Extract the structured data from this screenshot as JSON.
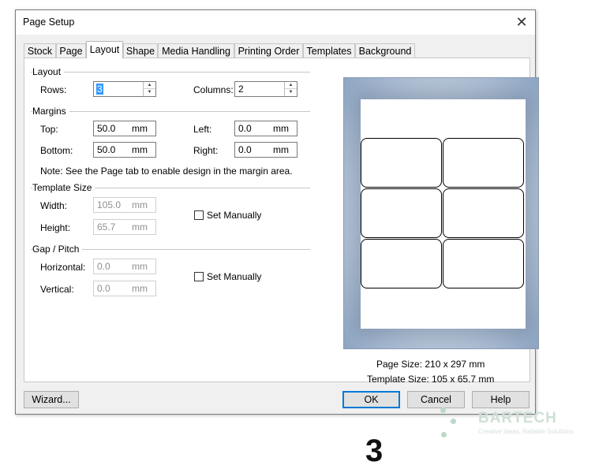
{
  "window": {
    "title": "Page Setup",
    "close_glyph": "✕"
  },
  "tabs": [
    "Stock",
    "Page",
    "Layout",
    "Shape",
    "Media Handling",
    "Printing Order",
    "Templates",
    "Background"
  ],
  "active_tab": "Layout",
  "layout": {
    "group": "Layout",
    "rows_label": "Rows:",
    "rows_value": "3",
    "columns_label": "Columns:",
    "columns_value": "2"
  },
  "margins": {
    "group": "Margins",
    "top_label": "Top:",
    "top_value": "50.0",
    "bottom_label": "Bottom:",
    "bottom_value": "50.0",
    "left_label": "Left:",
    "left_value": "0.0",
    "right_label": "Right:",
    "right_value": "0.0",
    "unit": "mm",
    "note": "Note: See the Page tab to enable design in the margin area."
  },
  "template_size": {
    "group": "Template Size",
    "width_label": "Width:",
    "width_value": "105.0",
    "height_label": "Height:",
    "height_value": "65.7",
    "unit": "mm",
    "set_manually": "Set Manually"
  },
  "gap_pitch": {
    "group": "Gap / Pitch",
    "horizontal_label": "Horizontal:",
    "horizontal_value": "0.0",
    "vertical_label": "Vertical:",
    "vertical_value": "0.0",
    "unit": "mm",
    "set_manually": "Set Manually"
  },
  "preview": {
    "page_size": "Page Size:  210 x 297 mm",
    "template_size": "Template Size:  105 x 65.7 mm",
    "rows": 3,
    "columns": 2
  },
  "buttons": {
    "wizard": "Wizard...",
    "ok": "OK",
    "cancel": "Cancel",
    "help": "Help"
  },
  "watermark": {
    "brand": "BARTECH",
    "tagline": "Creative Ideas, Reliable Solutions"
  },
  "bottom_digit": "3"
}
